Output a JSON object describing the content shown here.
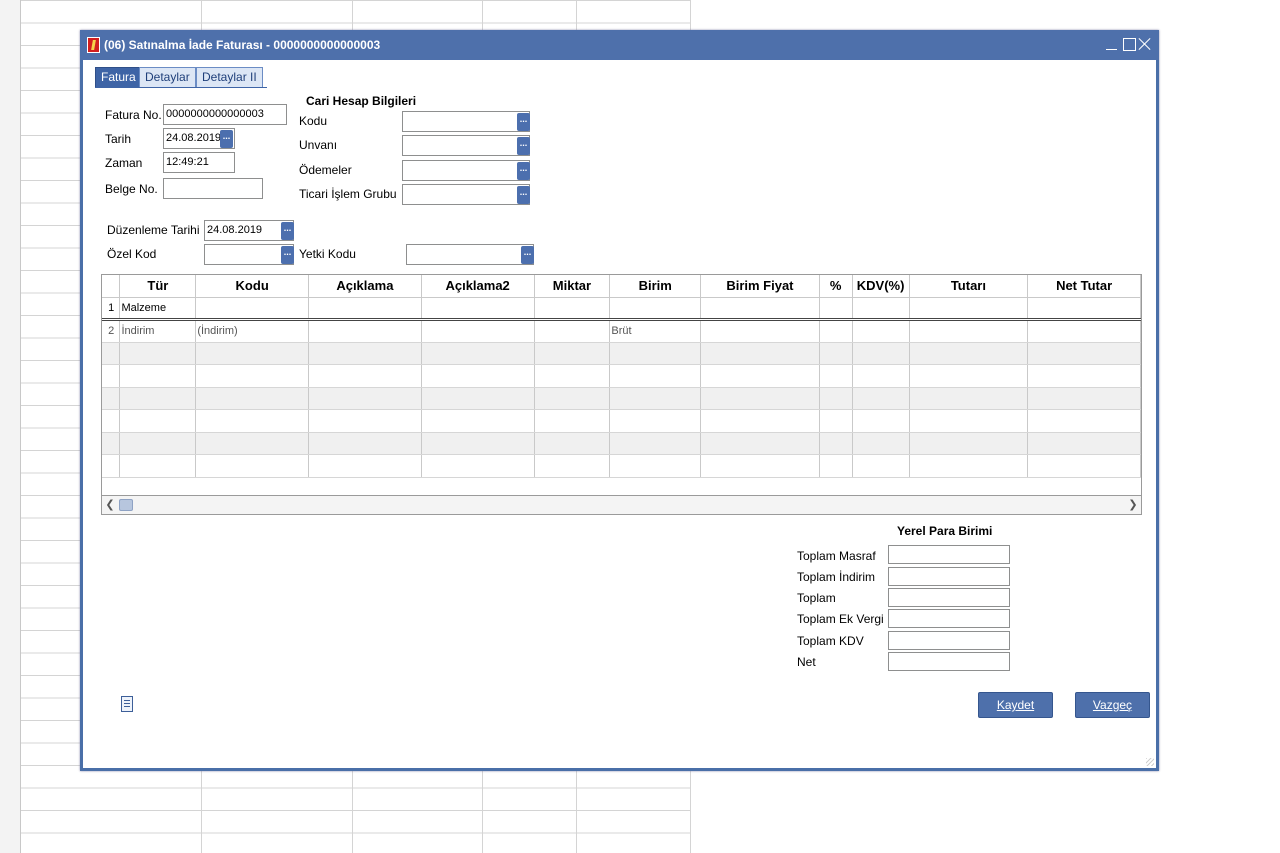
{
  "window": {
    "title": "(06) Satınalma İade Faturası - 0000000000000003"
  },
  "tabs": [
    {
      "label": "Fatura"
    },
    {
      "label": "Detaylar"
    },
    {
      "label": "Detaylar II"
    }
  ],
  "invoice": {
    "fatura_no_label": "Fatura No.",
    "fatura_no_value": "0000000000000003",
    "tarih_label": "Tarih",
    "tarih_value": "24.08.2019",
    "zaman_label": "Zaman",
    "zaman_value": "12:49:21",
    "belge_no_label": "Belge No.",
    "belge_no_value": "",
    "duzenleme_tarihi_label": "Düzenleme Tarihi",
    "duzenleme_tarihi_value": "24.08.2019",
    "ozel_kod_label": "Özel Kod",
    "ozel_kod_value": "",
    "yetki_kodu_label": "Yetki Kodu",
    "yetki_kodu_value": ""
  },
  "cari": {
    "heading": "Cari Hesap Bilgileri",
    "kodu_label": "Kodu",
    "kodu_value": "",
    "unvani_label": "Unvanı",
    "unvani_value": "",
    "odemeler_label": "Ödemeler",
    "odemeler_value": "",
    "ticari_label": "Ticari İşlem Grubu",
    "ticari_value": ""
  },
  "grid": {
    "columns": [
      "",
      "Tür",
      "Kodu",
      "Açıklama",
      "Açıklama2",
      "Miktar",
      "Birim",
      "Birim Fiyat",
      "%",
      "KDV(%)",
      "Tutarı",
      "Net Tutar"
    ],
    "rows": [
      [
        "1",
        "Malzeme",
        "",
        "",
        "",
        "",
        "",
        "",
        "",
        "",
        "",
        ""
      ],
      [
        "2",
        "İndirim",
        "(İndirim)",
        "",
        "",
        "",
        "Brüt",
        "",
        "",
        "",
        "",
        ""
      ],
      [
        "",
        "",
        "",
        "",
        "",
        "",
        "",
        "",
        "",
        "",
        "",
        ""
      ],
      [
        "",
        "",
        "",
        "",
        "",
        "",
        "",
        "",
        "",
        "",
        "",
        ""
      ],
      [
        "",
        "",
        "",
        "",
        "",
        "",
        "",
        "",
        "",
        "",
        "",
        ""
      ],
      [
        "",
        "",
        "",
        "",
        "",
        "",
        "",
        "",
        "",
        "",
        "",
        ""
      ],
      [
        "",
        "",
        "",
        "",
        "",
        "",
        "",
        "",
        "",
        "",
        "",
        ""
      ],
      [
        "",
        "",
        "",
        "",
        "",
        "",
        "",
        "",
        "",
        "",
        "",
        ""
      ]
    ]
  },
  "totals": {
    "heading": "Yerel Para Birimi",
    "items": [
      {
        "label": "Toplam Masraf",
        "value": ""
      },
      {
        "label": "Toplam İndirim",
        "value": ""
      },
      {
        "label": "Toplam",
        "value": ""
      },
      {
        "label": "Toplam Ek Vergi",
        "value": ""
      },
      {
        "label": "Toplam KDV",
        "value": ""
      },
      {
        "label": "Net",
        "value": ""
      }
    ]
  },
  "buttons": {
    "save": "Kaydet",
    "cancel": "Vazgeç",
    "lookup": "..."
  },
  "colors": {
    "titlebar": "#4e70ab",
    "button": "#4e70ab",
    "tab_active": "#3e64a6"
  }
}
